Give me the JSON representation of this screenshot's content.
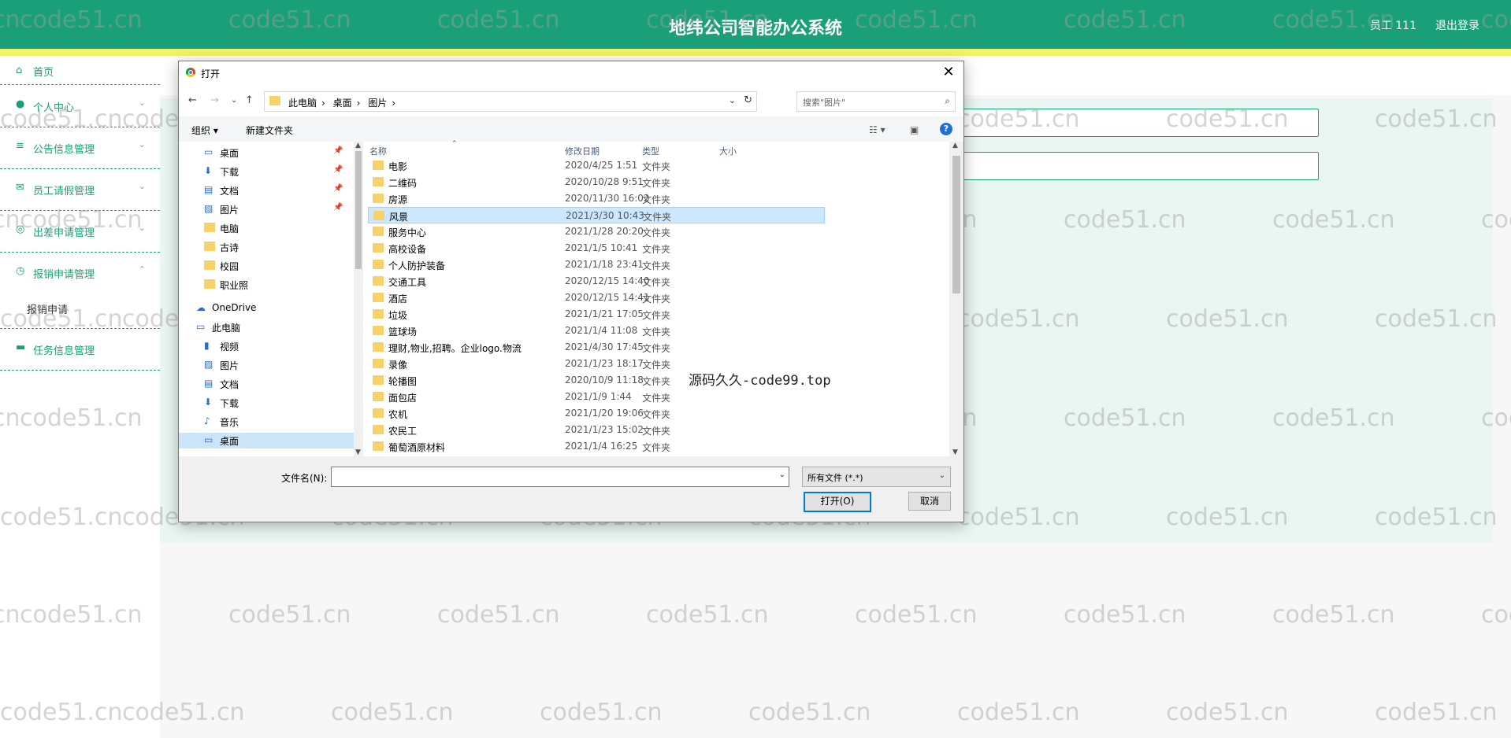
{
  "header": {
    "title": "地纬公司智能办公系统",
    "user": "员工 111",
    "logout": "退出登录"
  },
  "sidebar": {
    "items": [
      {
        "label": "首页",
        "icon": "home-icon"
      },
      {
        "label": "个人中心",
        "icon": "user-icon"
      },
      {
        "label": "公告信息管理",
        "icon": "list-icon"
      },
      {
        "label": "员工请假管理",
        "icon": "mail-icon"
      },
      {
        "label": "出差申请管理",
        "icon": "compass-icon"
      },
      {
        "label": "报销申请管理",
        "icon": "clock-icon"
      },
      {
        "label": "任务信息管理",
        "icon": "monitor-icon"
      }
    ],
    "sub_item": "报销申请"
  },
  "watermark": "code51.cn",
  "overlay_text": "源码久久-code99.top",
  "dialog": {
    "title": "打开",
    "close": "✕",
    "address": [
      "此电脑",
      "桌面",
      "图片"
    ],
    "search_placeholder": "搜索\"图片\"",
    "toolbar": {
      "organize": "组织 ▾",
      "new_folder": "新建文件夹",
      "help": "?"
    },
    "nav_pane": [
      {
        "label": "桌面",
        "icon": "desktop-icon",
        "pinned": true
      },
      {
        "label": "下载",
        "icon": "download-icon",
        "pinned": true
      },
      {
        "label": "文档",
        "icon": "document-icon",
        "pinned": true
      },
      {
        "label": "图片",
        "icon": "picture-icon",
        "pinned": true
      },
      {
        "label": "电脑",
        "icon": "folder-icon",
        "pinned": false
      },
      {
        "label": "古诗",
        "icon": "folder-icon",
        "pinned": false
      },
      {
        "label": "校园",
        "icon": "folder-icon",
        "pinned": false
      },
      {
        "label": "职业照",
        "icon": "folder-icon",
        "pinned": false
      },
      {
        "label": "OneDrive",
        "icon": "cloud-icon",
        "pinned": false
      },
      {
        "label": "此电脑",
        "icon": "computer-icon",
        "pinned": false
      },
      {
        "label": "视频",
        "icon": "video-icon",
        "pinned": false
      },
      {
        "label": "图片",
        "icon": "picture-icon",
        "pinned": false
      },
      {
        "label": "文档",
        "icon": "document-icon",
        "pinned": false
      },
      {
        "label": "下载",
        "icon": "download-icon",
        "pinned": false
      },
      {
        "label": "音乐",
        "icon": "music-icon",
        "pinned": false
      },
      {
        "label": "桌面",
        "icon": "desktop-icon",
        "pinned": false
      }
    ],
    "columns": {
      "name": "名称",
      "date": "修改日期",
      "type": "类型",
      "size": "大小"
    },
    "files": [
      {
        "name": "电影",
        "date": "2020/4/25 1:51",
        "type": "文件夹"
      },
      {
        "name": "二维码",
        "date": "2020/10/28 9:51",
        "type": "文件夹"
      },
      {
        "name": "房源",
        "date": "2020/11/30 16:02",
        "type": "文件夹"
      },
      {
        "name": "风景",
        "date": "2021/3/30 10:43",
        "type": "文件夹",
        "selected": true
      },
      {
        "name": "服务中心",
        "date": "2021/1/28 20:20",
        "type": "文件夹"
      },
      {
        "name": "高校设备",
        "date": "2021/1/5 10:41",
        "type": "文件夹"
      },
      {
        "name": "个人防护装备",
        "date": "2021/1/18 23:41",
        "type": "文件夹"
      },
      {
        "name": "交通工具",
        "date": "2020/12/15 14:40",
        "type": "文件夹"
      },
      {
        "name": "酒店",
        "date": "2020/12/15 14:41",
        "type": "文件夹"
      },
      {
        "name": "垃圾",
        "date": "2021/1/21 17:05",
        "type": "文件夹"
      },
      {
        "name": "篮球场",
        "date": "2021/1/4 11:08",
        "type": "文件夹"
      },
      {
        "name": "理财,物业,招聘。企业logo.物流",
        "date": "2021/4/30 17:45",
        "type": "文件夹"
      },
      {
        "name": "录像",
        "date": "2021/1/23 18:17",
        "type": "文件夹"
      },
      {
        "name": "轮播图",
        "date": "2020/10/9 11:18",
        "type": "文件夹"
      },
      {
        "name": "面包店",
        "date": "2021/1/9 1:44",
        "type": "文件夹"
      },
      {
        "name": "农机",
        "date": "2021/1/20 19:06",
        "type": "文件夹"
      },
      {
        "name": "农民工",
        "date": "2021/1/23 15:02",
        "type": "文件夹"
      },
      {
        "name": "葡萄酒原材料",
        "date": "2021/1/4 16:25",
        "type": "文件夹"
      }
    ],
    "filename_label": "文件名(N):",
    "filename_value": "",
    "filter": "所有文件 (*.*)",
    "open_button": "打开(O)",
    "cancel_button": "取消"
  }
}
